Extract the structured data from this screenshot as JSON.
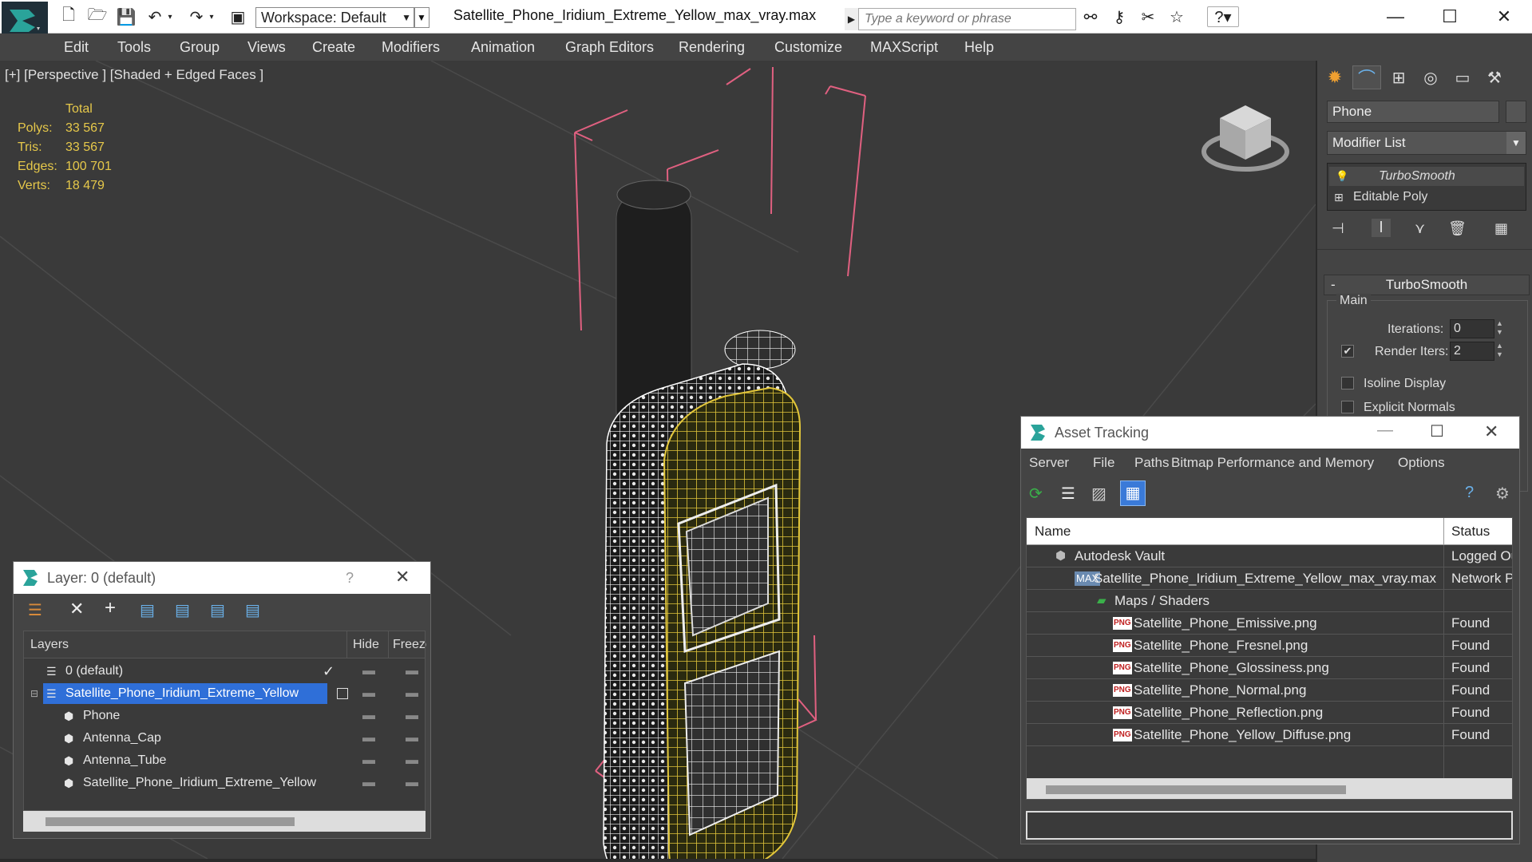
{
  "titlebar": {
    "workspace": "Workspace: Default",
    "file_title": "Satellite_Phone_Iridium_Extreme_Yellow_max_vray.max",
    "search_placeholder": "Type a keyword or phrase"
  },
  "menu": [
    "Edit",
    "Tools",
    "Group",
    "Views",
    "Create",
    "Modifiers",
    "Animation",
    "Graph Editors",
    "Rendering",
    "Customize",
    "MAXScript",
    "Help"
  ],
  "viewport": {
    "label": "[+] [Perspective ] [Shaded + Edged Faces ]",
    "stats_header": "Total",
    "stats": [
      {
        "label": "Polys:",
        "value": "33 567"
      },
      {
        "label": "Tris:",
        "value": "33 567"
      },
      {
        "label": "Edges:",
        "value": "100 701"
      },
      {
        "label": "Verts:",
        "value": "18 479"
      }
    ]
  },
  "command_panel": {
    "object_name": "Phone",
    "modifier_list": "Modifier List",
    "stack": [
      "TurboSmooth",
      "Editable Poly"
    ],
    "rollout_title": "TurboSmooth",
    "group_main": "Main",
    "iterations_label": "Iterations:",
    "iterations_value": "0",
    "render_iters_label": "Render Iters:",
    "render_iters_value": "2",
    "render_iters_checked": true,
    "isoline_label": "Isoline Display",
    "explicit_normals_label": "Explicit Normals"
  },
  "layer_dialog": {
    "title": "Layer: 0 (default)",
    "help": "?",
    "columns": {
      "layers": "Layers",
      "hide": "Hide",
      "freeze": "Freeze"
    },
    "rows": [
      {
        "name": "0 (default)",
        "level": 0,
        "type": "layer",
        "current": true,
        "selected": false
      },
      {
        "name": "Satellite_Phone_Iridium_Extreme_Yellow",
        "level": 0,
        "type": "layer",
        "current": false,
        "selected": true
      },
      {
        "name": "Phone",
        "level": 1,
        "type": "object",
        "selected": false
      },
      {
        "name": "Antenna_Cap",
        "level": 1,
        "type": "object",
        "selected": false
      },
      {
        "name": "Antenna_Tube",
        "level": 1,
        "type": "object",
        "selected": false
      },
      {
        "name": "Satellite_Phone_Iridium_Extreme_Yellow",
        "level": 1,
        "type": "object",
        "selected": false
      }
    ]
  },
  "asset_dialog": {
    "title": "Asset Tracking",
    "menu": [
      "Server",
      "File",
      "Paths",
      "Bitmap Performance and Memory",
      "Options"
    ],
    "columns": {
      "name": "Name",
      "status": "Status"
    },
    "rows": [
      {
        "name": "Autodesk Vault",
        "status": "Logged Ou",
        "level": 0,
        "icon": "vault"
      },
      {
        "name": "Satellite_Phone_Iridium_Extreme_Yellow_max_vray.max",
        "status": "Network P",
        "level": 1,
        "icon": "max"
      },
      {
        "name": "Maps / Shaders",
        "status": "",
        "level": 2,
        "icon": "maps"
      },
      {
        "name": "Satellite_Phone_Emissive.png",
        "status": "Found",
        "level": 3,
        "icon": "png"
      },
      {
        "name": "Satellite_Phone_Fresnel.png",
        "status": "Found",
        "level": 3,
        "icon": "png"
      },
      {
        "name": "Satellite_Phone_Glossiness.png",
        "status": "Found",
        "level": 3,
        "icon": "png"
      },
      {
        "name": "Satellite_Phone_Normal.png",
        "status": "Found",
        "level": 3,
        "icon": "png"
      },
      {
        "name": "Satellite_Phone_Reflection.png",
        "status": "Found",
        "level": 3,
        "icon": "png"
      },
      {
        "name": "Satellite_Phone_Yellow_Diffuse.png",
        "status": "Found",
        "level": 3,
        "icon": "png"
      }
    ]
  },
  "colors": {
    "stats": "#e6c84a",
    "wireframe_yellow": "#d4b72a",
    "selection_blue": "#2f6fd8",
    "bbox_pink": "#e06080"
  }
}
